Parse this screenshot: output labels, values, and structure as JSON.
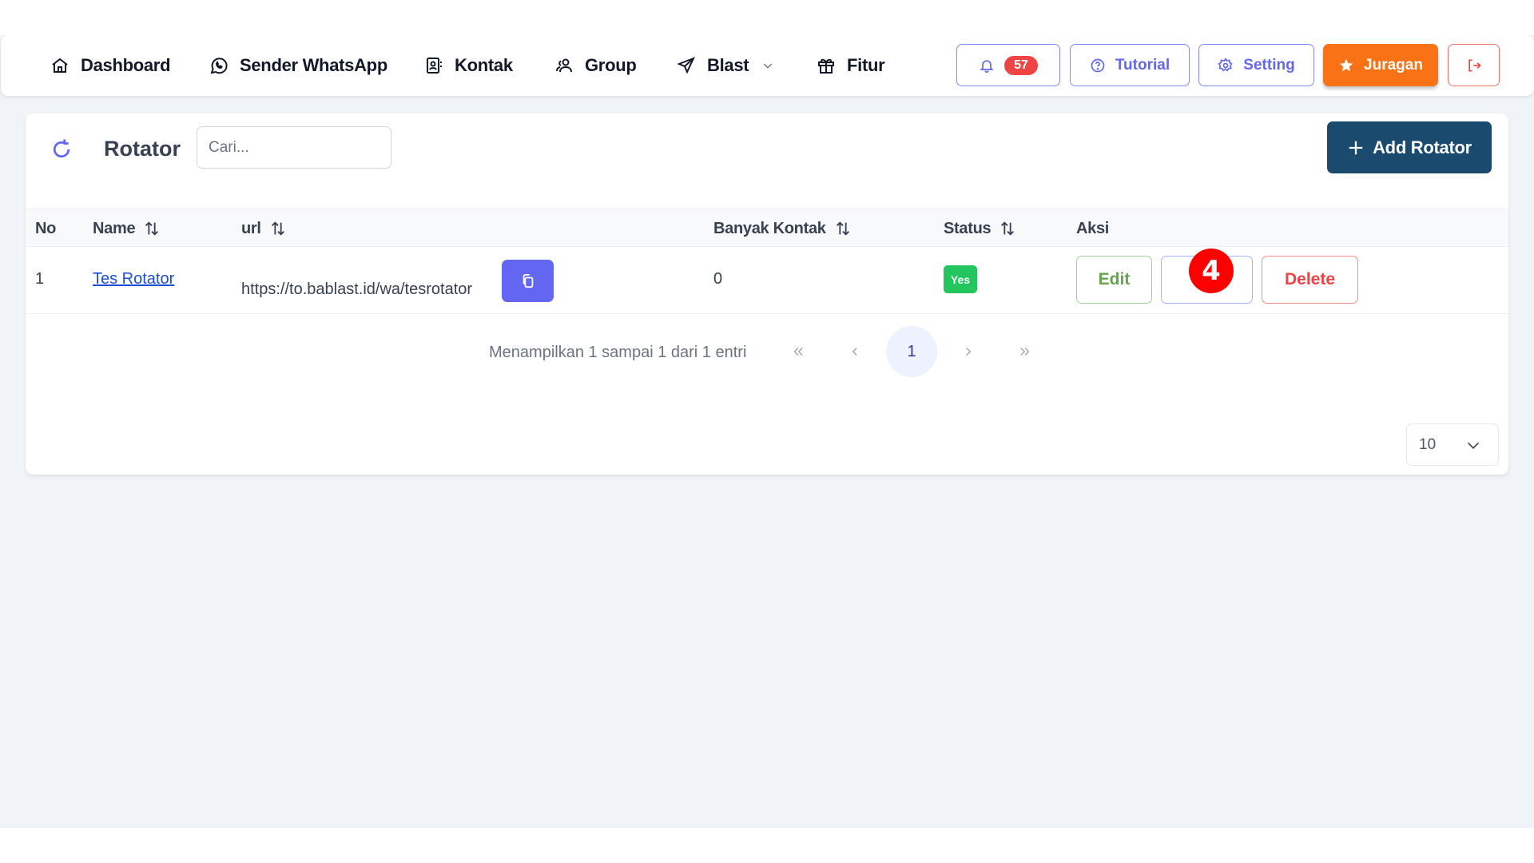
{
  "nav": {
    "items": [
      {
        "label": "Dashboard",
        "icon": "home-icon"
      },
      {
        "label": "Sender WhatsApp",
        "icon": "whatsapp-icon"
      },
      {
        "label": "Kontak",
        "icon": "contact-book-icon"
      },
      {
        "label": "Group",
        "icon": "users-icon"
      },
      {
        "label": "Blast",
        "icon": "send-icon",
        "has_dropdown": true
      },
      {
        "label": "Fitur",
        "icon": "gift-icon"
      }
    ],
    "notifications_count": "57",
    "tutorial_label": "Tutorial",
    "setting_label": "Setting",
    "juragan_label": "Juragan",
    "accent_color": "#6366f1",
    "juragan_color": "#f97316",
    "logout_color": "#ef4444"
  },
  "page": {
    "title": "Rotator",
    "search_placeholder": "Cari...",
    "search_value": "",
    "add_button_label": "Add Rotator",
    "add_button_color": "#1a4a6e"
  },
  "table": {
    "columns": [
      "No",
      "Name",
      "url",
      "Banyak Kontak",
      "Status",
      "Aksi"
    ],
    "rows": [
      {
        "no": "1",
        "name": "Tes Rotator",
        "url": "https://to.bablast.id/wa/tesrotator",
        "banyak_kontak": "0",
        "status": "Yes",
        "actions": {
          "edit": "Edit",
          "middle": "",
          "delete": "Delete"
        }
      }
    ]
  },
  "annotation_marker": "4",
  "pagination": {
    "info": "Menampilkan 1 sampai 1 dari 1 entri",
    "current_page": "1",
    "per_page": "10"
  }
}
